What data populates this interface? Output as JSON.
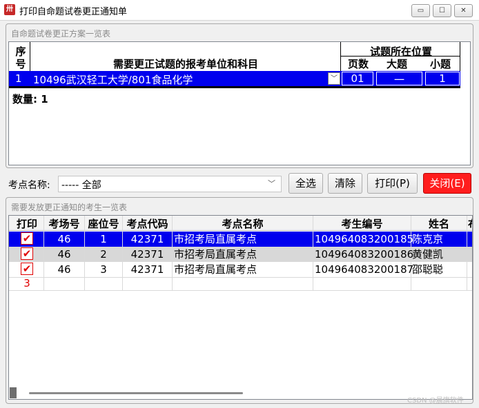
{
  "window": {
    "icon_text": "卅",
    "title": "打印自命题试卷更正通知单",
    "min_glyph": "▭",
    "max_glyph": "☐",
    "close_glyph": "✕"
  },
  "plan_group": {
    "title": "自命题试卷更正方案一览表",
    "headers": {
      "seq_line1": "序",
      "seq_line2": "号",
      "unit_subject": "需要更正试题的报考单位和科目",
      "position": "试题所在位置",
      "page": "页数",
      "big_q": "大题",
      "small_q": "小题"
    },
    "rows": [
      {
        "seq": "1",
        "unit": "10496武汉轻工大学/801食品化学",
        "page": "01",
        "big_q": "一",
        "small_q": "1"
      }
    ],
    "count_label": "数量: 1"
  },
  "filter": {
    "site_label": "考点名称:",
    "site_value": "-----  全部",
    "buttons": {
      "select_all": "全选",
      "clear": "清除",
      "print": "打印(P)",
      "close": "关闭(E)"
    }
  },
  "student_group": {
    "title": "需要发放更正通知的考生一览表",
    "headers": {
      "print": "打印",
      "room": "考场号",
      "seat": "座位号",
      "site_code": "考点代码",
      "site_name": "考点名称",
      "exam_no": "考生编号",
      "name": "姓名",
      "extra": "布"
    },
    "rows": [
      {
        "checked": "✔",
        "room": "46",
        "seat": "1",
        "site_code": "42371",
        "site_name": "市招考局直属考点",
        "exam_no": "104964083200185",
        "name": "陈克京"
      },
      {
        "checked": "✔",
        "room": "46",
        "seat": "2",
        "site_code": "42371",
        "site_name": "市招考局直属考点",
        "exam_no": "104964083200186",
        "name": "黄健凯"
      },
      {
        "checked": "✔",
        "room": "46",
        "seat": "3",
        "site_code": "42371",
        "site_name": "市招考局直属考点",
        "exam_no": "104964083200187",
        "name": "邵聪聪"
      }
    ],
    "total": "3"
  },
  "watermark": "CSDN @晨旗软件",
  "colors": {
    "selection": "#0000ee",
    "close_button": "#ff1d1d",
    "check": "#e00000"
  }
}
